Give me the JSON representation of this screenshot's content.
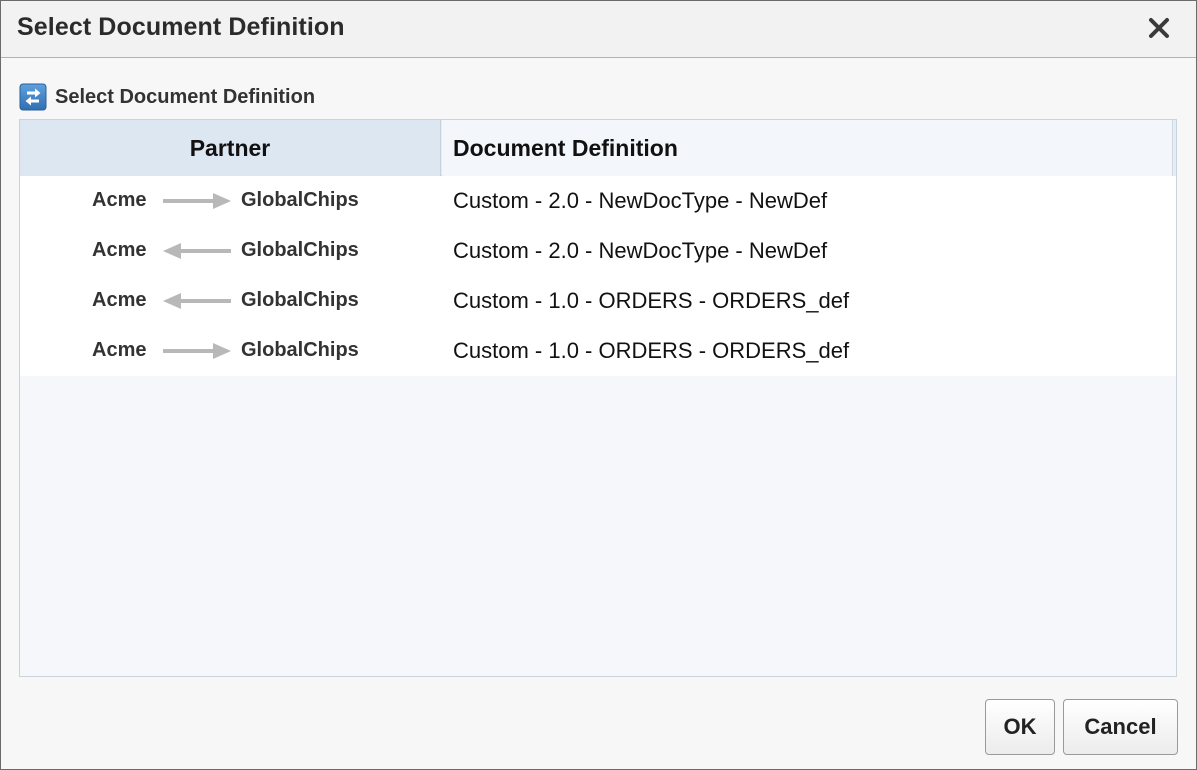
{
  "dialog": {
    "title": "Select Document Definition",
    "close_icon": "close-icon"
  },
  "section": {
    "title": "Select Document Definition",
    "icon": "swap-arrows-icon"
  },
  "table": {
    "columns": {
      "partner": "Partner",
      "document_definition": "Document Definition"
    },
    "rows": [
      {
        "from": "Acme",
        "direction": "right",
        "to": "GlobalChips",
        "definition": "Custom - 2.0 - NewDocType - NewDef"
      },
      {
        "from": "Acme",
        "direction": "left",
        "to": "GlobalChips",
        "definition": "Custom - 2.0 - NewDocType - NewDef"
      },
      {
        "from": "Acme",
        "direction": "left",
        "to": "GlobalChips",
        "definition": "Custom - 1.0 - ORDERS - ORDERS_def"
      },
      {
        "from": "Acme",
        "direction": "right",
        "to": "GlobalChips",
        "definition": "Custom - 1.0 - ORDERS - ORDERS_def"
      }
    ]
  },
  "buttons": {
    "ok": "OK",
    "cancel": "Cancel"
  },
  "colors": {
    "arrow": "#b8b8b8",
    "icon_bg": "#3b7dc4",
    "header_bg": "#e4ecf4"
  }
}
